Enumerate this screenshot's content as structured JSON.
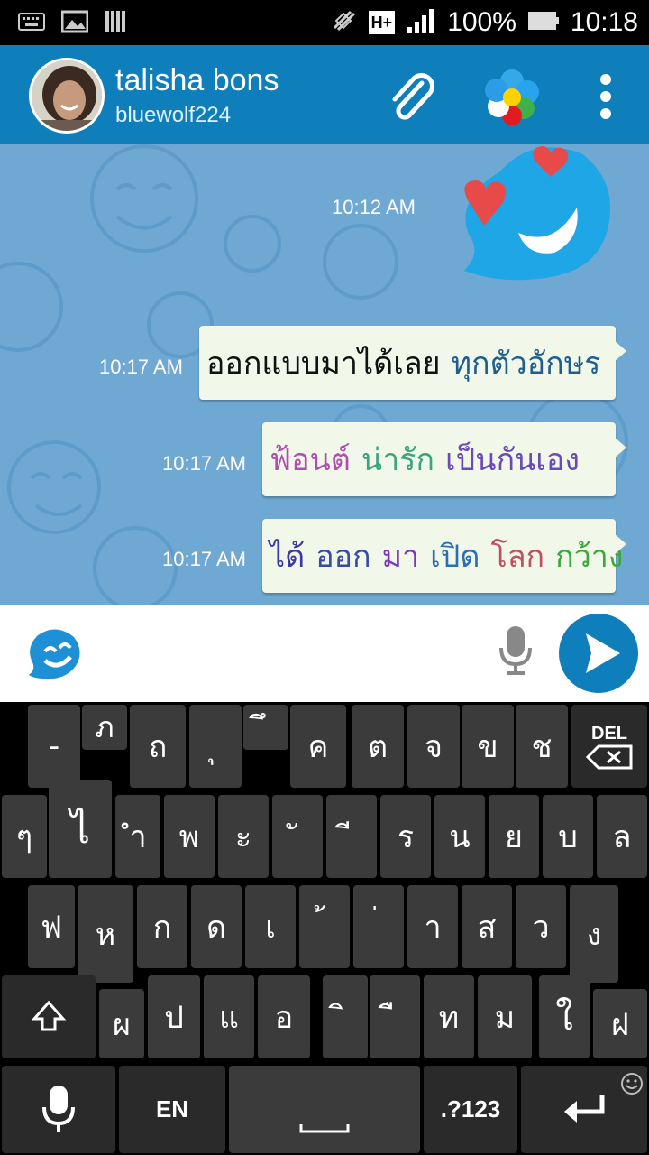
{
  "status_bar": {
    "network": "H+",
    "battery_percent": "100%",
    "time": "10:18",
    "icons": [
      "keyboard-icon",
      "image-icon",
      "sim-icon",
      "mute-icon",
      "network-icon",
      "signal-icon",
      "battery-icon"
    ]
  },
  "header": {
    "name": "talisha bons",
    "username": "bluewolf224",
    "icons": [
      "paperclip-icon",
      "flower-icon",
      "overflow-menu-icon"
    ]
  },
  "chat": {
    "sticker_time": "10:12 AM",
    "messages": [
      {
        "time": "10:17 AM",
        "words": [
          {
            "text": "ออกแบบมาได้เลย",
            "color": "#111111"
          },
          {
            "text": "ทุกตัวอักษร",
            "color": "#1f5f8f"
          }
        ]
      },
      {
        "time": "10:17 AM",
        "words": [
          {
            "text": "ฟ้อนต์",
            "color": "#b04db0"
          },
          {
            "text": "น่ารัก",
            "color": "#38a57f"
          },
          {
            "text": "เป็นกันเอง",
            "color": "#6a49b8"
          }
        ]
      },
      {
        "time": "10:17 AM",
        "words": [
          {
            "text": "ได้",
            "color": "#3a3aa8"
          },
          {
            "text": "ออก",
            "color": "#3a4aa8"
          },
          {
            "text": "มา",
            "color": "#7a3ab8"
          },
          {
            "text": "เปิด",
            "color": "#2b6fb2"
          },
          {
            "text": "โลก",
            "color": "#c0505f"
          },
          {
            "text": "กว้าง",
            "color": "#3aa83a"
          }
        ]
      }
    ]
  },
  "input_bar": {
    "placeholder": "",
    "icons": [
      "emoji-icon",
      "microphone-icon",
      "send-icon"
    ]
  },
  "keyboard": {
    "row1": [
      "-",
      "ภ",
      "ถ",
      "ุ",
      "ึ",
      "ค",
      "ต",
      "จ",
      "ข",
      "ช"
    ],
    "del_label": "DEL",
    "row2": [
      "ๆ",
      "ไ",
      "ำ",
      "พ",
      "ะ",
      "ั",
      "ี",
      "ร",
      "น",
      "ย",
      "บ",
      "ล"
    ],
    "row3": [
      "ฟ",
      "ห",
      "ก",
      "ด",
      "เ",
      "้",
      "่",
      "า",
      "ส",
      "ว",
      "ง"
    ],
    "row4": [
      "ผ",
      "ป",
      "แ",
      "อ",
      "ิ",
      "ื",
      "ท",
      "ม",
      "ใ",
      "ฝ"
    ],
    "lang_label": "EN",
    "symbols_label": ".?123",
    "icons": [
      "shift-icon",
      "backspace-icon",
      "microphone-icon",
      "space-icon",
      "enter-icon",
      "smiley-icon"
    ]
  }
}
